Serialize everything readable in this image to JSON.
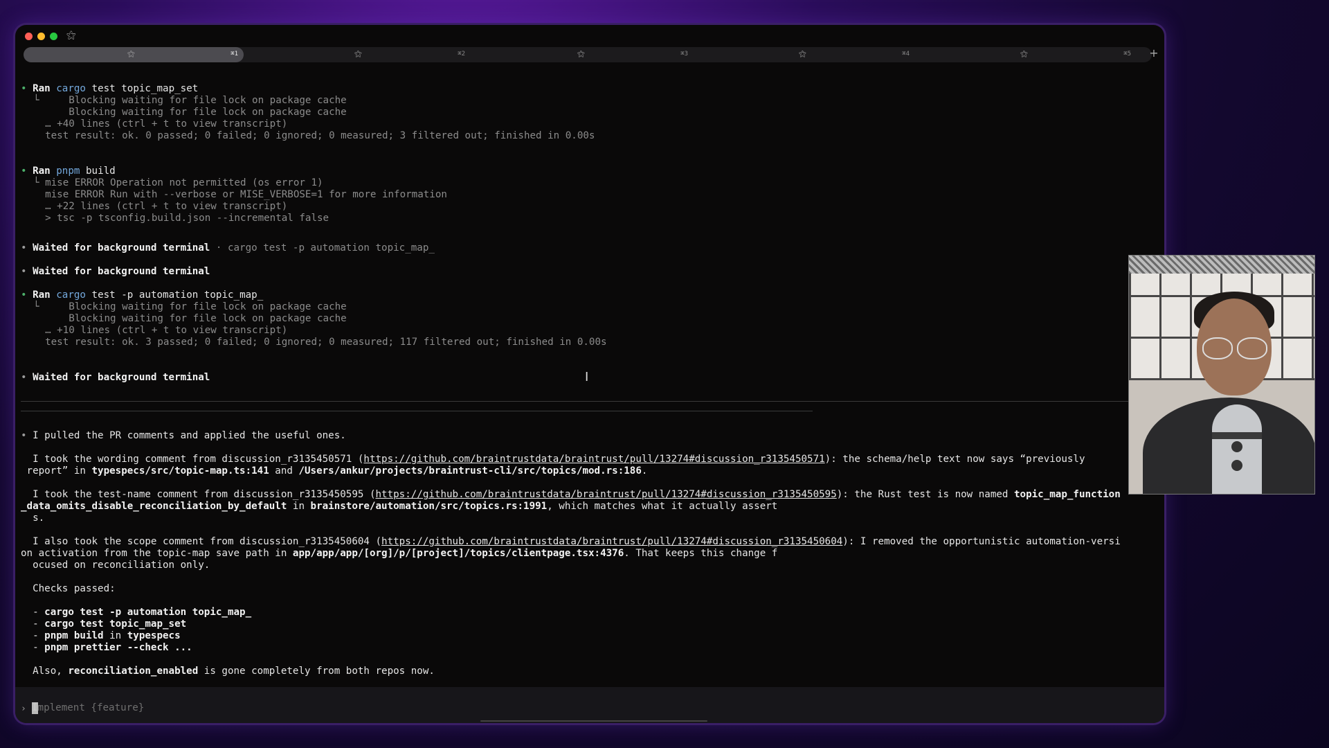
{
  "window": {
    "app_icon": "⚝"
  },
  "tabs": [
    {
      "icon": "⚝",
      "shortcut": "⌘1",
      "active": true
    },
    {
      "icon": "⚝",
      "shortcut": "⌘2",
      "active": false
    },
    {
      "icon": "⚝",
      "shortcut": "⌘3",
      "active": false
    },
    {
      "icon": "⚝",
      "shortcut": "⌘4",
      "active": false
    },
    {
      "icon": "⚝",
      "shortcut": "⌘5",
      "active": false
    }
  ],
  "new_tab_label": "+",
  "transcript": {
    "block1": {
      "ran": "Ran",
      "tool": "cargo",
      "args": "test topic_map_set",
      "lines": [
        "└     Blocking waiting for file lock on package cache",
        "      Blocking waiting for file lock on package cache",
        "  … +40 lines (ctrl + t to view transcript)",
        "  test result: ok. 0 passed; 0 failed; 0 ignored; 0 measured; 3 filtered out; finished in 0.00s"
      ]
    },
    "block2": {
      "ran": "Ran",
      "tool": "pnpm",
      "args": "build",
      "lines": [
        "└ mise ERROR Operation not permitted (os error 1)",
        "  mise ERROR Run with --verbose or MISE_VERBOSE=1 for more information",
        "  … +22 lines (ctrl + t to view transcript)",
        "  > tsc -p tsconfig.build.json --incremental false"
      ]
    },
    "waited1": {
      "label": "Waited for background terminal",
      "detail": " · cargo test -p automation topic_map_"
    },
    "waited2": {
      "label": "Waited for background terminal"
    },
    "block3": {
      "ran": "Ran",
      "tool": "cargo",
      "args": "test -p automation topic_map_",
      "lines": [
        "└     Blocking waiting for file lock on package cache",
        "      Blocking waiting for file lock on package cache",
        "  … +10 lines (ctrl + t to view transcript)",
        "  test result: ok. 3 passed; 0 failed; 0 ignored; 0 measured; 117 filtered out; finished in 0.00s"
      ]
    },
    "waited3": {
      "label": "Waited for background terminal"
    }
  },
  "message": {
    "intro": "I pulled the PR comments and applied the useful ones.",
    "p1": {
      "a": "  I took the wording comment from discussion_r3135450571 (",
      "link": "https://github.com/braintrustdata/braintrust/pull/13274#discussion_r3135450571",
      "b": "): the schema/help text now says “previously",
      "c": " report” in ",
      "file1": "typespecs/src/topic-map.ts:141",
      "d": " and ",
      "file2": "/Users/ankur/projects/braintrust-cli/src/topics/mod.rs:186",
      "e": "."
    },
    "p2": {
      "a": "  I took the test-name comment from discussion_r3135450595 (",
      "link": "https://github.com/braintrustdata/braintrust/pull/13274#discussion_r3135450595",
      "b": "): the Rust test is now named ",
      "name1": "topic_map_function",
      "name2": "_data_omits_disable_reconciliation_by_default",
      "c": " in ",
      "file": "brainstore/automation/src/topics.rs:1991",
      "d": ", which matches what it actually assert",
      "e": "  s."
    },
    "p3": {
      "a": "  I also took the scope comment from discussion_r3135450604 (",
      "link": "https://github.com/braintrustdata/braintrust/pull/13274#discussion_r3135450604",
      "b": "): I removed the opportunistic automation-versi",
      "c": "on activation from the topic-map save path in ",
      "file": "app/app/app/[org]/p/[project]/topics/clientpage.tsx:4376",
      "d": ". That keeps this change f",
      "e": "  ocused on reconciliation only."
    },
    "checks_title": "  Checks passed:",
    "checks": [
      {
        "dash": "  - ",
        "text": "cargo test -p automation topic_map_",
        "suffix": ""
      },
      {
        "dash": "  - ",
        "text": "cargo test topic_map_set",
        "suffix": ""
      },
      {
        "dash": "  - ",
        "text": "pnpm build",
        "mid": " in ",
        "text2": "typespecs"
      },
      {
        "dash": "  - ",
        "text": "pnpm prettier --check ...",
        "suffix": ""
      }
    ],
    "also": {
      "a": "  Also, ",
      "code": "reconciliation_enabled",
      "b": " is gone completely from both repos now."
    }
  },
  "composer": {
    "arrow": "›",
    "placeholder": "Implement {feature}"
  }
}
